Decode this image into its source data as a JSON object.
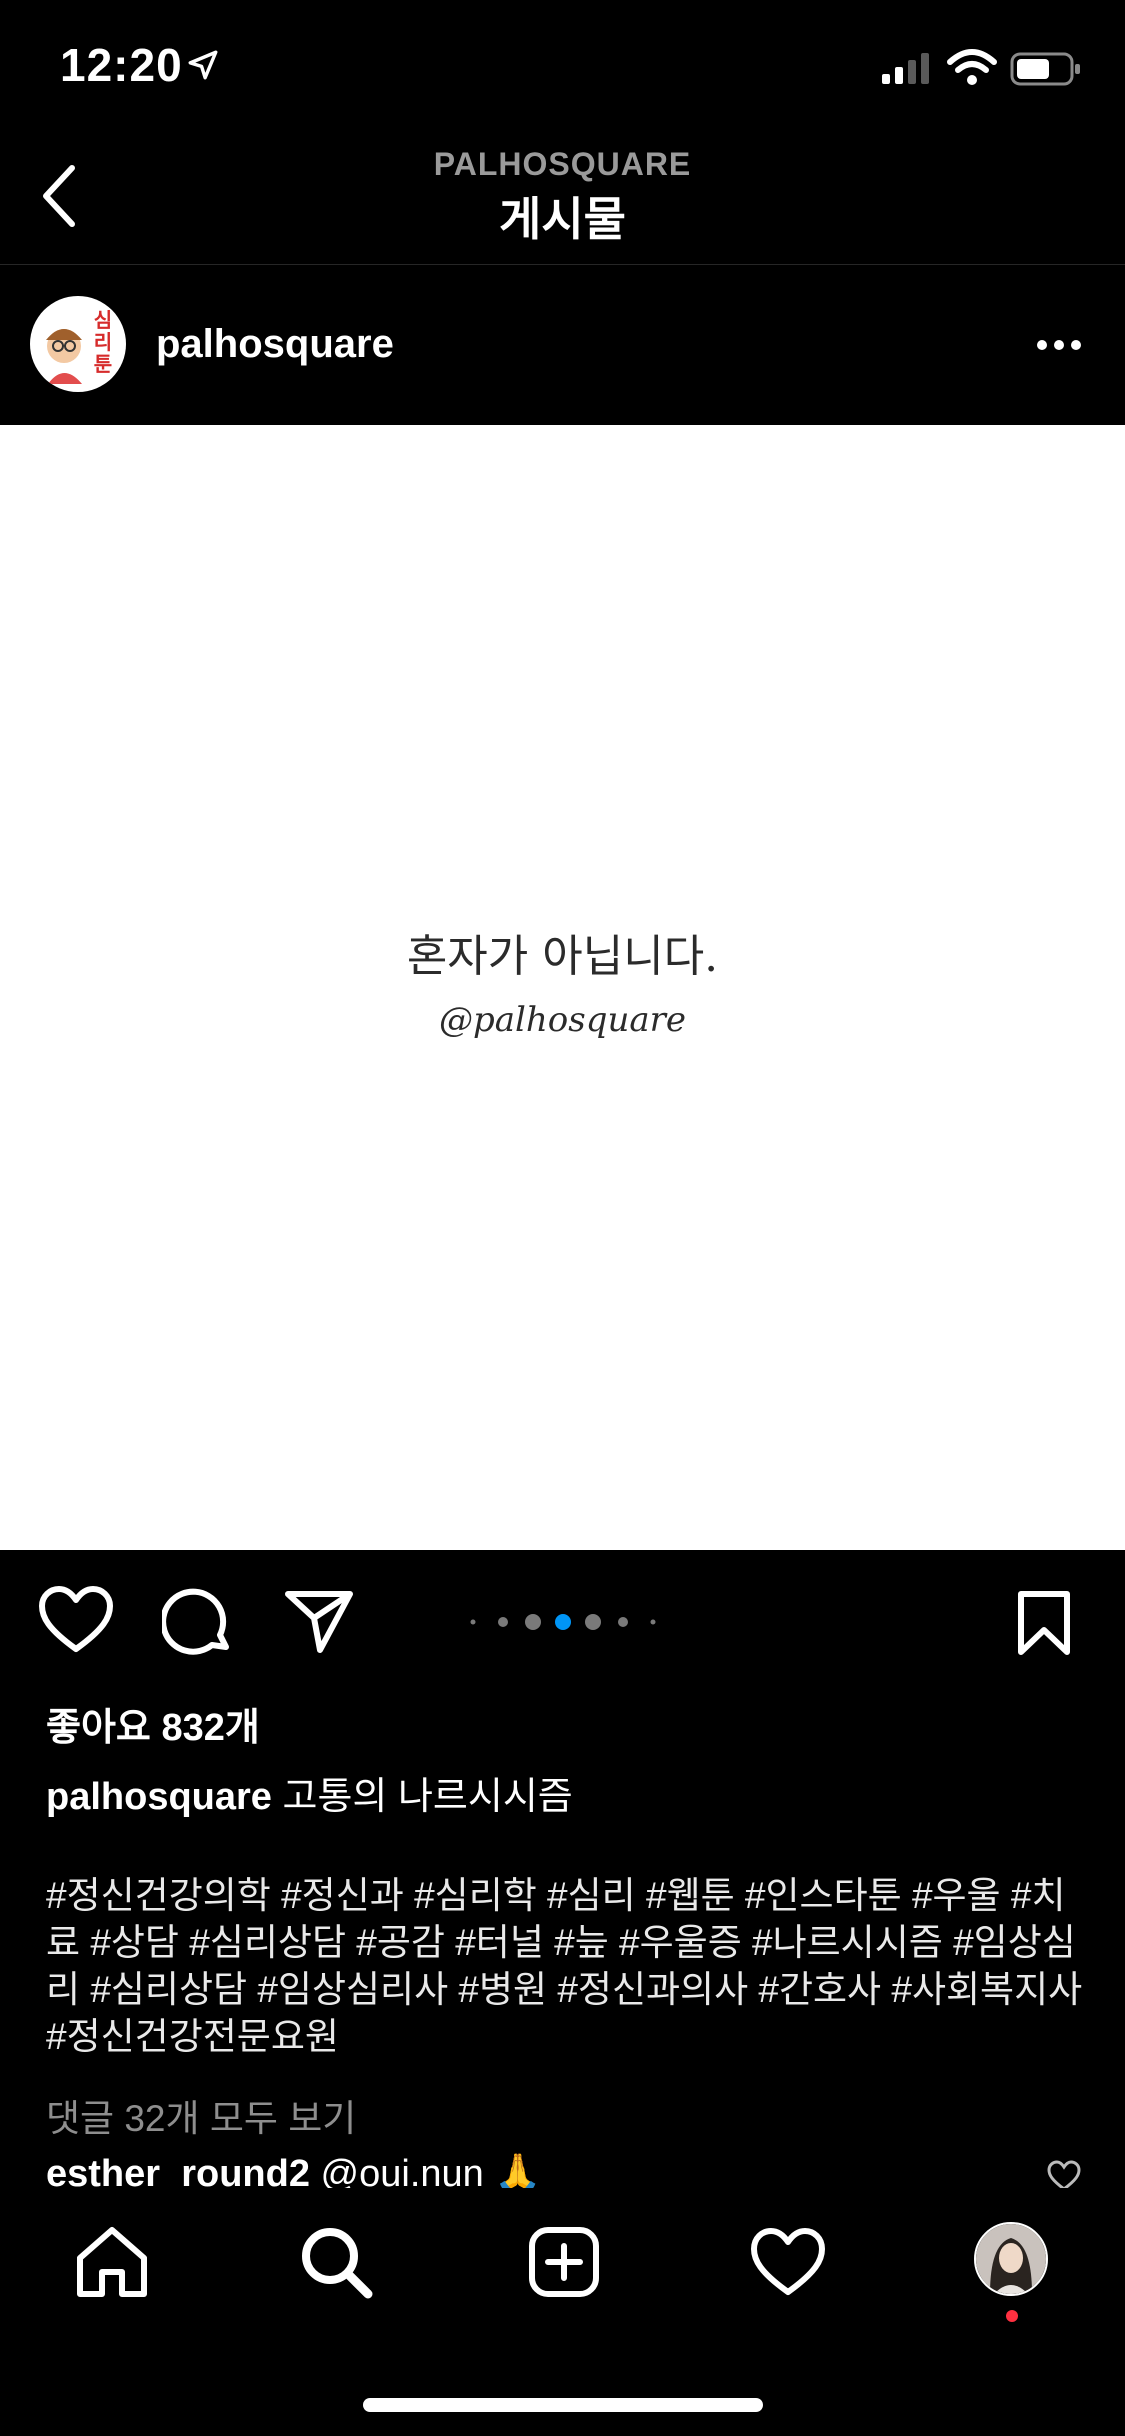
{
  "status_bar": {
    "time": "12:20"
  },
  "header": {
    "account": "PALHOSQUARE",
    "title": "게시물"
  },
  "post": {
    "username": "palhosquare",
    "avatar_text": "심리툰",
    "image_text_main": "혼자가 아닙니다.",
    "image_text_handle": "@palhosquare",
    "carousel": {
      "total": 7,
      "active": 4
    },
    "likes": "좋아요 832개",
    "caption_user": "palhosquare",
    "caption_text": "고통의 나르시시즘",
    "hashtags": "#정신건강의학 #정신과 #심리학 #심리 #웹툰 #인스타툰 #우울 #치료 #상담 #심리상담 #공감 #터널 #늪 #우울증 #나르시시즘 #임상심리 #심리상담 #임상심리사 #병원 #정신과의사 #간호사 #사회복지사 #정신건강전문요원",
    "view_comments": "댓글 32개 모두 보기",
    "comment_user": "esther_round2",
    "comment_text": "@oui.nun 🙏"
  },
  "colors": {
    "accent_blue": "#0095f6",
    "notification_red": "#ff3040"
  },
  "icons": [
    "back-chevron-icon",
    "more-icon",
    "heart-icon",
    "comment-icon",
    "share-icon",
    "bookmark-icon",
    "home-icon",
    "search-icon",
    "add-post-icon",
    "activity-heart-icon"
  ]
}
